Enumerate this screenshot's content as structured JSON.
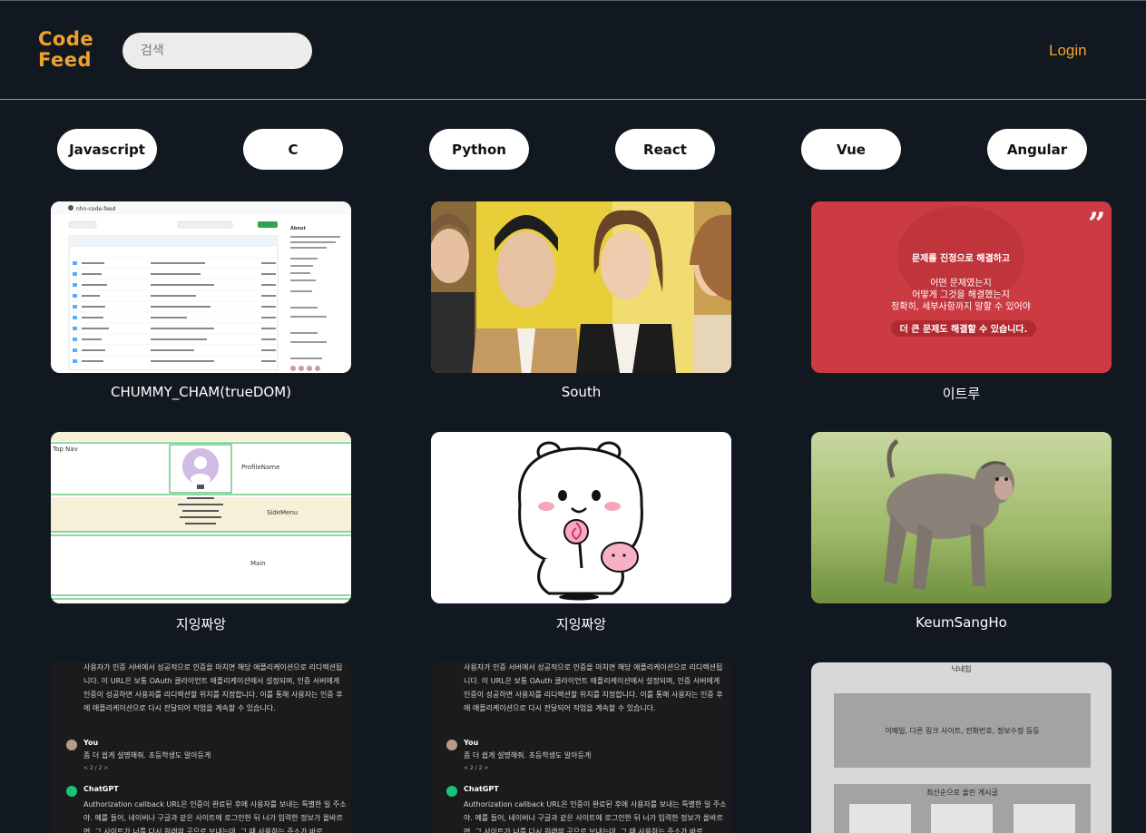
{
  "header": {
    "logo_line1": "Code",
    "logo_line2": "Feed",
    "search_placeholder": "검색",
    "login_label": "Login"
  },
  "tags": [
    "Javascript",
    "C",
    "Python",
    "React",
    "Vue",
    "Angular"
  ],
  "posts": [
    {
      "author": "CHUMMY_CHAM(trueDOM)"
    },
    {
      "author": "South"
    },
    {
      "author": "이트루"
    },
    {
      "author": "지잉짜앙"
    },
    {
      "author": "지잉짜앙"
    },
    {
      "author": "KeumSangHo"
    },
    {
      "author": ""
    },
    {
      "author": ""
    },
    {
      "author": ""
    }
  ],
  "thumb_text": {
    "red": {
      "line1": "문제를 진정으로 해결하고",
      "line2": "어떤 문제였는지",
      "line3": "어떻게 그것을 해결했는지",
      "line4": "정확히, 세부사항까지 말할 수 있어야",
      "line5": "더 큰 문제도 해결할 수 있습니다."
    },
    "chat": {
      "para1": "사용자가 인증 서버에서 성공적으로 인증을 마치면 해당 애플리케이션으로 리디렉션됩니다. 이 URL은 보통 OAuth 클라이언트 애플리케이션에서 설정되며, 인증 서버에게 인증이 성공하면 사용자를 리디렉션할 위치를 지정합니다. 이를 통해 사용자는 인증 후에 애플리케이션으로 다시 전달되어 작업을 계속할 수 있습니다.",
      "you_label": "You",
      "you_text": "좀 더 쉽게 설명해줘. 초등학생도 알아듣게",
      "pager": "< 2 / 2 >",
      "gpt_label": "ChatGPT",
      "gpt_text": "Authorization callback URL은 인증이 완료된 후에 사용자를 보내는 특별한 일 주소야. 예를 들어, 네이버나 구글과 같은 사이트에 로그인한 뒤 너가 입력한 정보가 올바르면, 그 사이트가 너를 다시 원래의 곳으로 보내는데, 그 때 사용하는 주소가 바로"
    },
    "wire": {
      "nickname": "닉네임",
      "info": "이메일, 다른 링크 사이트, 전화번호, 정보수정 등등",
      "recent": "최신순으로 올린 게시글"
    },
    "profile": {
      "topbar": "Top Nav",
      "profile_name": "ProfileName",
      "side": "SideMenu",
      "main": "Main"
    },
    "github": {
      "repo": "nhn-code-feed",
      "about": "About"
    }
  },
  "colors": {
    "background": "#121820",
    "accent": "#f0a030",
    "tag_bg": "#ffffff",
    "red_card": "#cc3a42"
  }
}
